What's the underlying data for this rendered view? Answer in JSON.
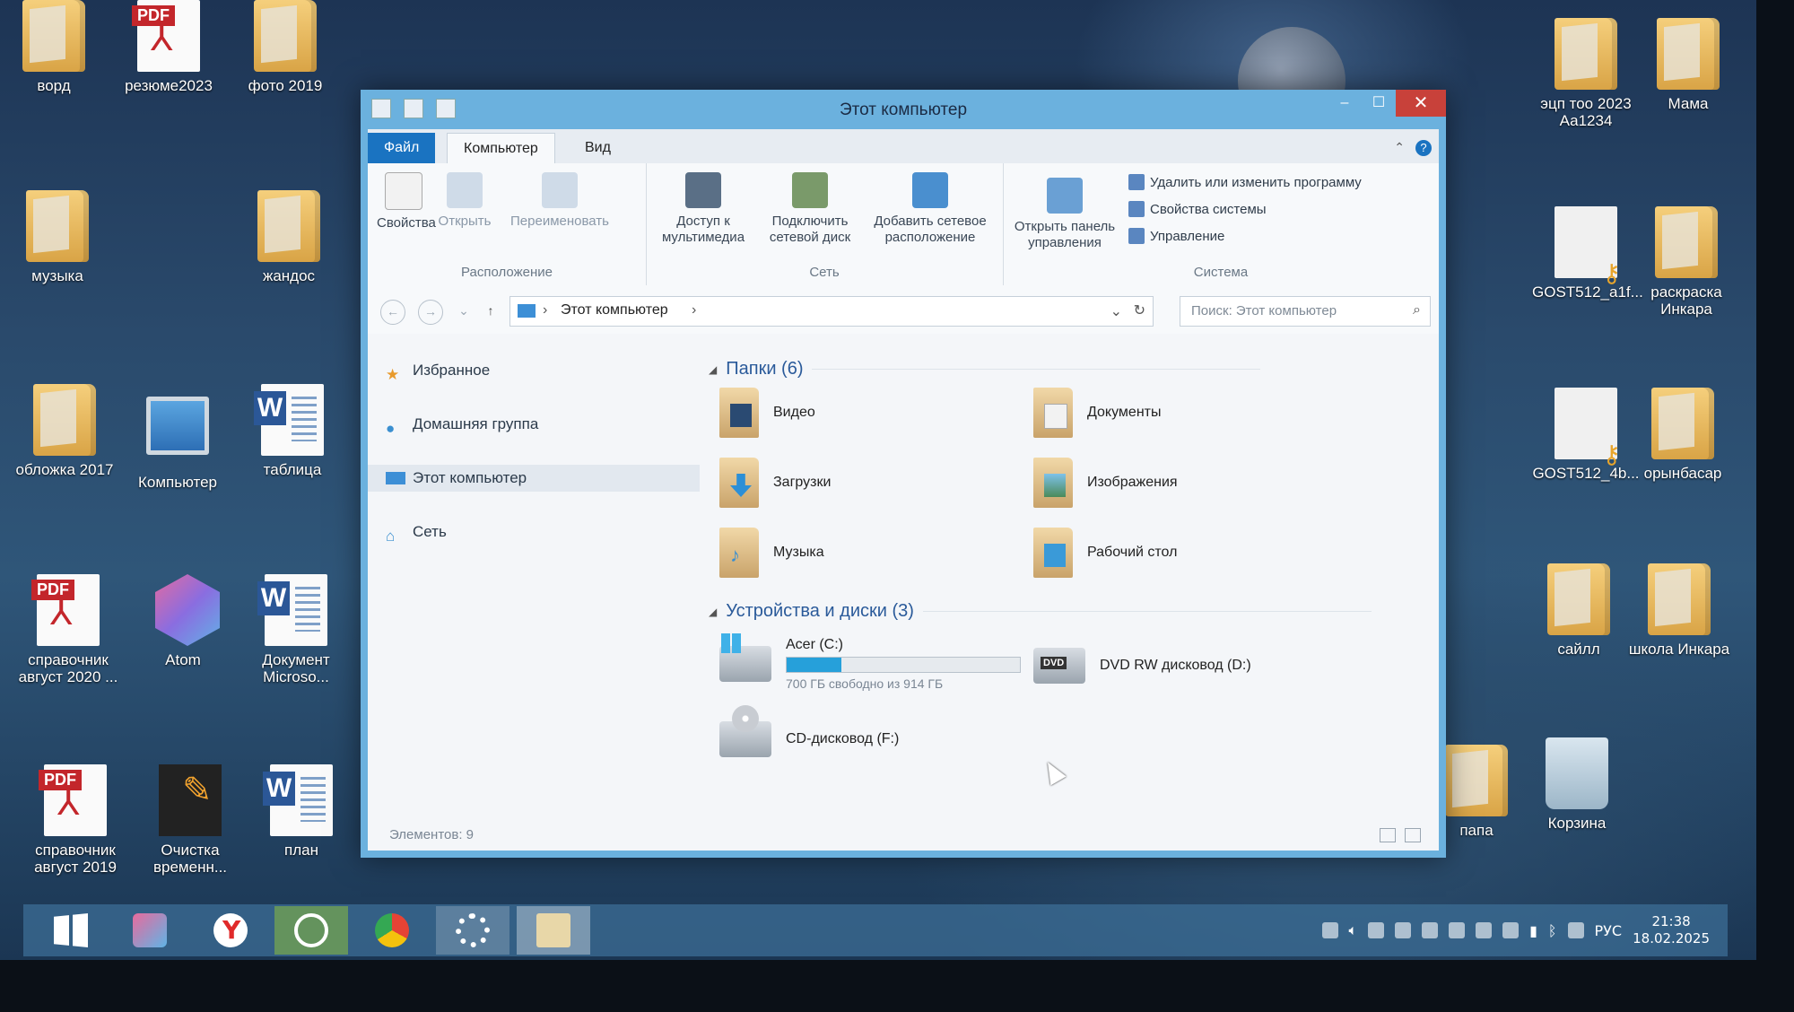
{
  "desktop": {
    "icons": [
      {
        "label": "ворд"
      },
      {
        "label": "резюме2023",
        "badge": "PDF"
      },
      {
        "label": "фото 2019"
      },
      {
        "label": "музыка"
      },
      {
        "label": "жандос"
      },
      {
        "label": "обложка 2017"
      },
      {
        "label": "Компьютер"
      },
      {
        "label": "таблица",
        "badge": "W"
      },
      {
        "label": "справочник август 2020 ...",
        "badge": "PDF"
      },
      {
        "label": "Atom"
      },
      {
        "label": "Документ Microso...",
        "badge": "W"
      },
      {
        "label": "справочник август 2019",
        "badge": "PDF"
      },
      {
        "label": "Очистка временн..."
      },
      {
        "label": "план",
        "badge": "W"
      },
      {
        "label": "эцп тоо 2023 Аа1234"
      },
      {
        "label": "Мама"
      },
      {
        "label": "GOST512_a1f..."
      },
      {
        "label": "раскраска Инкара"
      },
      {
        "label": "GOST512_4b..."
      },
      {
        "label": "орынбасар"
      },
      {
        "label": "сайлл"
      },
      {
        "label": "школа Инкара"
      },
      {
        "label": "папа"
      },
      {
        "label": "Корзина"
      }
    ]
  },
  "window": {
    "title": "Этот компьютер",
    "tabs": {
      "file": "Файл",
      "computer": "Компьютер",
      "view": "Вид"
    },
    "ribbon": {
      "location": {
        "label": "Расположение",
        "properties": "Свойства",
        "open": "Открыть",
        "rename": "Переименовать"
      },
      "network": {
        "label": "Сеть",
        "media": "Доступ к мультимедиа",
        "map_drive": "Подключить сетевой диск",
        "add_location": "Добавить сетевое расположение"
      },
      "system": {
        "label": "Система",
        "control_panel": "Открыть панель управления",
        "uninstall": "Удалить или изменить программу",
        "sys_props": "Свойства системы",
        "manage": "Управление"
      }
    },
    "address": {
      "path": "Этот компьютер",
      "search_placeholder": "Поиск: Этот компьютер"
    },
    "nav": {
      "favorites": "Избранное",
      "homegroup": "Домашняя группа",
      "this_pc": "Этот компьютер",
      "network": "Сеть"
    },
    "folders": {
      "header": "Папки (6)",
      "items": [
        "Видео",
        "Документы",
        "Загрузки",
        "Изображения",
        "Музыка",
        "Рабочий стол"
      ]
    },
    "devices": {
      "header": "Устройства и диски (3)",
      "c_name": "Acer (C:)",
      "c_free": "700 ГБ свободно из 914 ГБ",
      "c_used_fraction": 0.234,
      "dvd_name": "DVD RW дисковод (D:)",
      "dvd_badge": "DVD",
      "cd_name": "CD-дисковод (F:)"
    },
    "status": "Элементов: 9"
  },
  "taskbar": {
    "lang": "РУС",
    "time": "21:38",
    "date": "18.02.2025"
  }
}
